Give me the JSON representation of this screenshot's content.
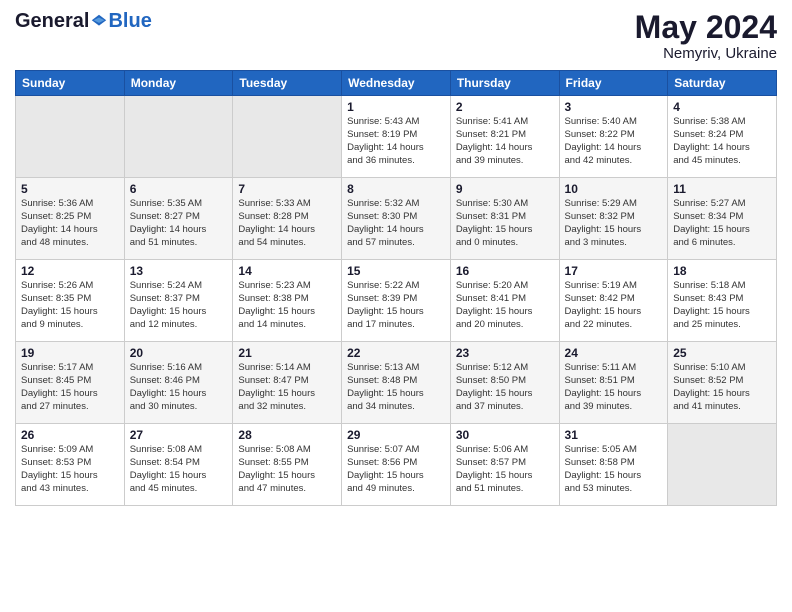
{
  "header": {
    "logo_general": "General",
    "logo_blue": "Blue",
    "month_year": "May 2024",
    "location": "Nemyriv, Ukraine"
  },
  "weekdays": [
    "Sunday",
    "Monday",
    "Tuesday",
    "Wednesday",
    "Thursday",
    "Friday",
    "Saturday"
  ],
  "weeks": [
    [
      {
        "day": "",
        "info": ""
      },
      {
        "day": "",
        "info": ""
      },
      {
        "day": "",
        "info": ""
      },
      {
        "day": "1",
        "info": "Sunrise: 5:43 AM\nSunset: 8:19 PM\nDaylight: 14 hours\nand 36 minutes."
      },
      {
        "day": "2",
        "info": "Sunrise: 5:41 AM\nSunset: 8:21 PM\nDaylight: 14 hours\nand 39 minutes."
      },
      {
        "day": "3",
        "info": "Sunrise: 5:40 AM\nSunset: 8:22 PM\nDaylight: 14 hours\nand 42 minutes."
      },
      {
        "day": "4",
        "info": "Sunrise: 5:38 AM\nSunset: 8:24 PM\nDaylight: 14 hours\nand 45 minutes."
      }
    ],
    [
      {
        "day": "5",
        "info": "Sunrise: 5:36 AM\nSunset: 8:25 PM\nDaylight: 14 hours\nand 48 minutes."
      },
      {
        "day": "6",
        "info": "Sunrise: 5:35 AM\nSunset: 8:27 PM\nDaylight: 14 hours\nand 51 minutes."
      },
      {
        "day": "7",
        "info": "Sunrise: 5:33 AM\nSunset: 8:28 PM\nDaylight: 14 hours\nand 54 minutes."
      },
      {
        "day": "8",
        "info": "Sunrise: 5:32 AM\nSunset: 8:30 PM\nDaylight: 14 hours\nand 57 minutes."
      },
      {
        "day": "9",
        "info": "Sunrise: 5:30 AM\nSunset: 8:31 PM\nDaylight: 15 hours\nand 0 minutes."
      },
      {
        "day": "10",
        "info": "Sunrise: 5:29 AM\nSunset: 8:32 PM\nDaylight: 15 hours\nand 3 minutes."
      },
      {
        "day": "11",
        "info": "Sunrise: 5:27 AM\nSunset: 8:34 PM\nDaylight: 15 hours\nand 6 minutes."
      }
    ],
    [
      {
        "day": "12",
        "info": "Sunrise: 5:26 AM\nSunset: 8:35 PM\nDaylight: 15 hours\nand 9 minutes."
      },
      {
        "day": "13",
        "info": "Sunrise: 5:24 AM\nSunset: 8:37 PM\nDaylight: 15 hours\nand 12 minutes."
      },
      {
        "day": "14",
        "info": "Sunrise: 5:23 AM\nSunset: 8:38 PM\nDaylight: 15 hours\nand 14 minutes."
      },
      {
        "day": "15",
        "info": "Sunrise: 5:22 AM\nSunset: 8:39 PM\nDaylight: 15 hours\nand 17 minutes."
      },
      {
        "day": "16",
        "info": "Sunrise: 5:20 AM\nSunset: 8:41 PM\nDaylight: 15 hours\nand 20 minutes."
      },
      {
        "day": "17",
        "info": "Sunrise: 5:19 AM\nSunset: 8:42 PM\nDaylight: 15 hours\nand 22 minutes."
      },
      {
        "day": "18",
        "info": "Sunrise: 5:18 AM\nSunset: 8:43 PM\nDaylight: 15 hours\nand 25 minutes."
      }
    ],
    [
      {
        "day": "19",
        "info": "Sunrise: 5:17 AM\nSunset: 8:45 PM\nDaylight: 15 hours\nand 27 minutes."
      },
      {
        "day": "20",
        "info": "Sunrise: 5:16 AM\nSunset: 8:46 PM\nDaylight: 15 hours\nand 30 minutes."
      },
      {
        "day": "21",
        "info": "Sunrise: 5:14 AM\nSunset: 8:47 PM\nDaylight: 15 hours\nand 32 minutes."
      },
      {
        "day": "22",
        "info": "Sunrise: 5:13 AM\nSunset: 8:48 PM\nDaylight: 15 hours\nand 34 minutes."
      },
      {
        "day": "23",
        "info": "Sunrise: 5:12 AM\nSunset: 8:50 PM\nDaylight: 15 hours\nand 37 minutes."
      },
      {
        "day": "24",
        "info": "Sunrise: 5:11 AM\nSunset: 8:51 PM\nDaylight: 15 hours\nand 39 minutes."
      },
      {
        "day": "25",
        "info": "Sunrise: 5:10 AM\nSunset: 8:52 PM\nDaylight: 15 hours\nand 41 minutes."
      }
    ],
    [
      {
        "day": "26",
        "info": "Sunrise: 5:09 AM\nSunset: 8:53 PM\nDaylight: 15 hours\nand 43 minutes."
      },
      {
        "day": "27",
        "info": "Sunrise: 5:08 AM\nSunset: 8:54 PM\nDaylight: 15 hours\nand 45 minutes."
      },
      {
        "day": "28",
        "info": "Sunrise: 5:08 AM\nSunset: 8:55 PM\nDaylight: 15 hours\nand 47 minutes."
      },
      {
        "day": "29",
        "info": "Sunrise: 5:07 AM\nSunset: 8:56 PM\nDaylight: 15 hours\nand 49 minutes."
      },
      {
        "day": "30",
        "info": "Sunrise: 5:06 AM\nSunset: 8:57 PM\nDaylight: 15 hours\nand 51 minutes."
      },
      {
        "day": "31",
        "info": "Sunrise: 5:05 AM\nSunset: 8:58 PM\nDaylight: 15 hours\nand 53 minutes."
      },
      {
        "day": "",
        "info": ""
      }
    ]
  ]
}
